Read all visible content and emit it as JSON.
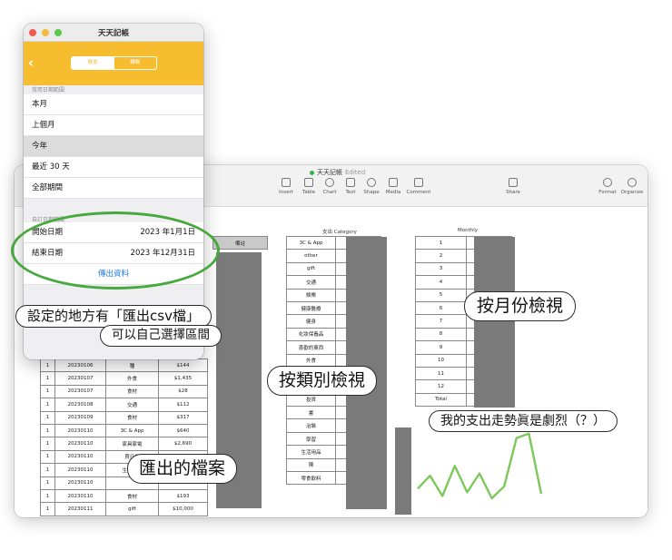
{
  "numbers_window": {
    "title": "天天記帳",
    "status": "Edited",
    "toolbar": [
      {
        "label": "Insert",
        "icon": "insert-icon"
      },
      {
        "label": "Table",
        "icon": "table-icon"
      },
      {
        "label": "Chart",
        "icon": "chart-icon"
      },
      {
        "label": "Text",
        "icon": "text-icon"
      },
      {
        "label": "Shape",
        "icon": "shape-icon"
      },
      {
        "label": "Media",
        "icon": "media-icon"
      },
      {
        "label": "Comment",
        "icon": "comment-icon"
      },
      {
        "label": "Share",
        "icon": "share-icon"
      },
      {
        "label": "Format",
        "icon": "format-icon"
      },
      {
        "label": "Organize",
        "icon": "organize-icon"
      }
    ],
    "records_table": {
      "note_header": "備註",
      "rows": [
        [
          "1",
          "20230106",
          "種",
          "$144"
        ],
        [
          "1",
          "20230107",
          "外食",
          "$1,435"
        ],
        [
          "1",
          "20230107",
          "食材",
          "$28"
        ],
        [
          "1",
          "20230108",
          "交通",
          "$112"
        ],
        [
          "1",
          "20230109",
          "食材",
          "$317"
        ],
        [
          "1",
          "20230110",
          "3C & App",
          "$640"
        ],
        [
          "1",
          "20230110",
          "家具家電",
          "$2,690"
        ],
        [
          "1",
          "20230110",
          "買日用",
          "$550"
        ],
        [
          "1",
          "20230110",
          "生活用品",
          "$222"
        ],
        [
          "1",
          "20230110",
          "",
          ""
        ],
        [
          "1",
          "20230110",
          "食材",
          "$193"
        ],
        [
          "1",
          "20230111",
          "gift",
          "$10,000"
        ]
      ]
    },
    "category_table": {
      "caption": "支出 Category",
      "rows": [
        "3C & App",
        "other",
        "gift",
        "交通",
        "娛樂",
        "健康醫療",
        "健身",
        "化妝保養品",
        "喜歡的東西",
        "外食",
        "家具家電",
        "買日用",
        "投資",
        "書",
        "治裝",
        "學習",
        "生活用品",
        "陳",
        "零食飲料"
      ]
    },
    "monthly_table": {
      "caption": "Monthly",
      "rows": [
        "1",
        "2",
        "3",
        "4",
        "5",
        "6",
        "7",
        "8",
        "9",
        "10",
        "11",
        "12",
        "Total"
      ]
    },
    "trend_line": {
      "values": [
        0.25,
        0.42,
        0.15,
        0.55,
        0.2,
        0.45,
        0.12,
        0.28,
        0.92,
        0.98,
        0.18
      ]
    }
  },
  "app_window": {
    "title": "天天記帳",
    "back_icon": "chevron-left-icon",
    "segments": [
      "收支",
      "轉帳"
    ],
    "section_common": "常用日期範圍",
    "ranges": [
      "本月",
      "上個月",
      "今年",
      "最近 30 天",
      "全部期間"
    ],
    "selected_range": "今年",
    "section_custom": "自訂日期範圍",
    "start_label": "開始日期",
    "start_value": "2023 年1月1日",
    "end_label": "結束日期",
    "end_value": "2023 年12月31日",
    "export_label": "傳出資料"
  },
  "annotations": {
    "export_location": "設定的地方有「匯出csv檔」",
    "custom_range": "可以自己選擇區間",
    "by_category": "按類別檢視",
    "by_month": "按月份檢視",
    "trend": "我的支出走勢眞是劇烈（？）",
    "exported_file": "匯出的檔案"
  }
}
